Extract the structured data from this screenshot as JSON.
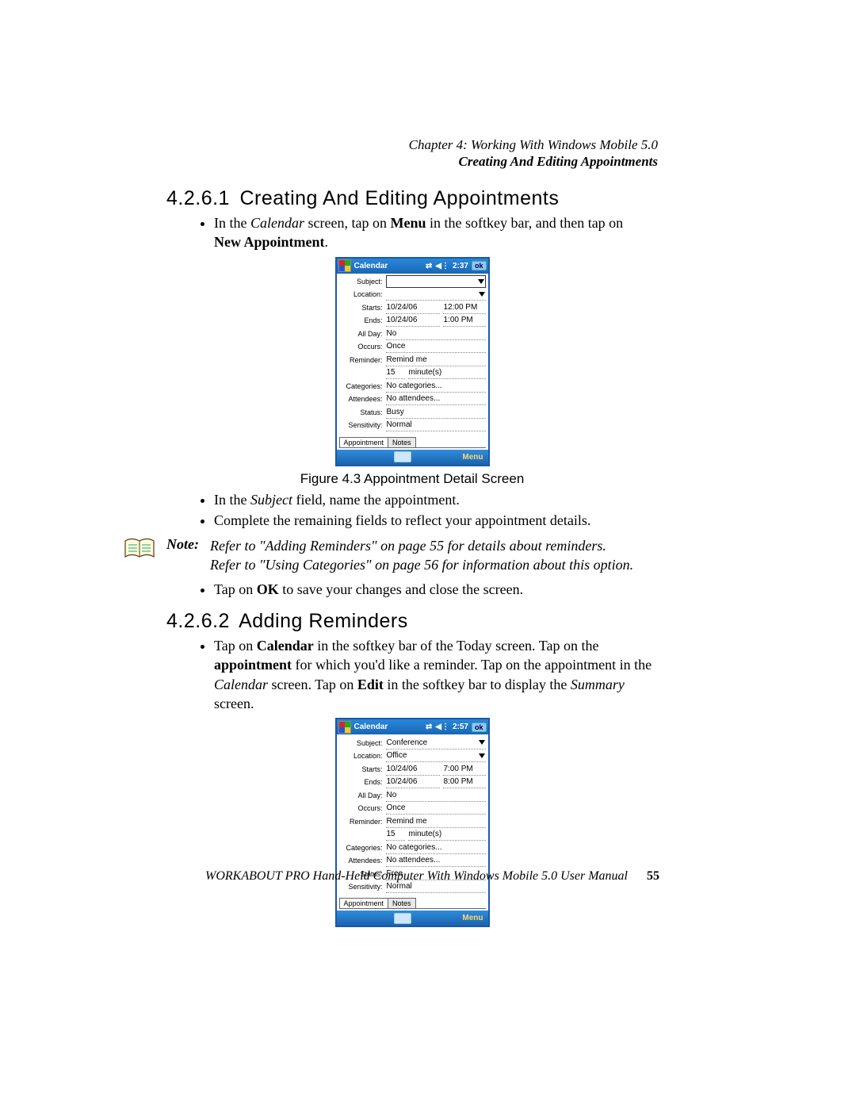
{
  "header": {
    "chapter_line": "Chapter 4:  Working With Windows Mobile 5.0",
    "subtitle": "Creating And Editing Appointments"
  },
  "section1": {
    "number": "4.2.6.1",
    "title": "Creating And Editing Appointments",
    "bullet1_pre": "In the ",
    "bullet1_cal": "Calendar",
    "bullet1_mid": " screen, tap on ",
    "bullet1_menu": "Menu",
    "bullet1_post": " in the softkey bar, and then tap on ",
    "bullet1_new": "New Appointment",
    "bullet1_end": ".",
    "caption": "Figure 4.3 Appointment Detail Screen",
    "bullet2_pre": "In the ",
    "bullet2_subj": "Subject",
    "bullet2_post": " field, name the appointment.",
    "bullet3": "Complete the remaining fields to reflect your appointment details.",
    "note_label": "Note:",
    "note_line1": "Refer to \"Adding Reminders\" on page 55 for details about reminders.",
    "note_line2": "Refer to \"Using Categories\" on page 56 for information about this option.",
    "bullet4_pre": "Tap on ",
    "bullet4_ok": "OK",
    "bullet4_post": " to save your changes and close the screen."
  },
  "section2": {
    "number": "4.2.6.2",
    "title": "Adding Reminders",
    "b_pre": "Tap on ",
    "b_cal": "Calendar",
    "b_t1": " in the softkey bar of the Today screen. Tap on the ",
    "b_appt": "appointment",
    "b_t2": " for which you'd like a reminder. Tap on the appointment in the ",
    "b_cal2": "Calendar",
    "b_t3": " screen. Tap on ",
    "b_edit": "Edit",
    "b_t4": " in the softkey bar to display the ",
    "b_sum": "Summary",
    "b_t5": " screen."
  },
  "wm1": {
    "title": "Calendar",
    "time": "2:37",
    "ok": "ok",
    "subject_lbl": "Subject:",
    "subject_val": "",
    "location_lbl": "Location:",
    "location_val": "",
    "starts_lbl": "Starts:",
    "starts_date": "10/24/06",
    "starts_time": "12:00 PM",
    "ends_lbl": "Ends:",
    "ends_date": "10/24/06",
    "ends_time": "1:00 PM",
    "allday_lbl": "All Day:",
    "allday_val": "No",
    "occurs_lbl": "Occurs:",
    "occurs_val": "Once",
    "reminder_lbl": "Reminder:",
    "reminder_val": "Remind me",
    "reminder_num": "15",
    "reminder_unit": "minute(s)",
    "categories_lbl": "Categories:",
    "categories_val": "No categories...",
    "attendees_lbl": "Attendees:",
    "attendees_val": "No attendees...",
    "status_lbl": "Status:",
    "status_val": "Busy",
    "sens_lbl": "Sensitivity:",
    "sens_val": "Normal",
    "tab1": "Appointment",
    "tab2": "Notes",
    "soft_menu": "Menu"
  },
  "wm2": {
    "title": "Calendar",
    "time": "2:57",
    "ok": "ok",
    "subject_lbl": "Subject:",
    "subject_val": "Conference",
    "location_lbl": "Location:",
    "location_val": "Office",
    "starts_lbl": "Starts:",
    "starts_date": "10/24/06",
    "starts_time": "7:00 PM",
    "ends_lbl": "Ends:",
    "ends_date": "10/24/06",
    "ends_time": "8:00 PM",
    "allday_lbl": "All Day:",
    "allday_val": "No",
    "occurs_lbl": "Occurs:",
    "occurs_val": "Once",
    "reminder_lbl": "Reminder:",
    "reminder_val": "Remind me",
    "reminder_num": "15",
    "reminder_unit": "minute(s)",
    "categories_lbl": "Categories:",
    "categories_val": "No categories...",
    "attendees_lbl": "Attendees:",
    "attendees_val": "No attendees...",
    "status_lbl": "Status:",
    "status_val": "Free",
    "sens_lbl": "Sensitivity:",
    "sens_val": "Normal",
    "tab1": "Appointment",
    "tab2": "Notes",
    "soft_menu": "Menu"
  },
  "footer": {
    "text": "WORKABOUT PRO Hand-Held Computer With Windows Mobile 5.0 User Manual",
    "page": "55"
  }
}
